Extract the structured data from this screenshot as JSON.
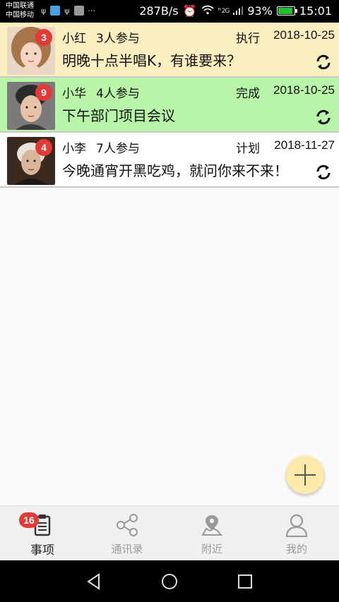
{
  "status_bar": {
    "carrier_1": "中国联通",
    "carrier_2": "中国移动",
    "speed": "287B/s",
    "network_labels": "ᴴ 2G",
    "battery": "93%",
    "battery_level": 0.93,
    "time": "15:01",
    "extra": "···"
  },
  "items": [
    {
      "name": "小红",
      "participants": "3人参与",
      "status": "执行",
      "date": "2018-10-25",
      "title": "明晚十点半唱K，有谁要来？",
      "badge": "3",
      "bg": "#fdeebf"
    },
    {
      "name": "小华",
      "participants": "4人参与",
      "status": "完成",
      "date": "2018-10-25",
      "title": "下午部门项目会议",
      "badge": "9",
      "bg": "#b8f5a8"
    },
    {
      "name": "小李",
      "participants": "7人参与",
      "status": "计划",
      "date": "2018-11-27",
      "title": "今晚通宵开黑吃鸡，就问你来不来！",
      "badge": "4",
      "bg": "#ffffff"
    }
  ],
  "tabs": [
    {
      "label": "事项",
      "icon": "clipboard-icon",
      "badge": "16",
      "active": true
    },
    {
      "label": "通讯录",
      "icon": "share-icon",
      "active": false
    },
    {
      "label": "附近",
      "icon": "map-pin-icon",
      "active": false
    },
    {
      "label": "我的",
      "icon": "person-icon",
      "active": false
    }
  ],
  "fab": {
    "icon": "plus-icon"
  },
  "colors": {
    "badge": "#e53935",
    "fab": "#ffe9a8",
    "tab_active": "#222222",
    "tab_inactive": "#9a9a9a"
  }
}
